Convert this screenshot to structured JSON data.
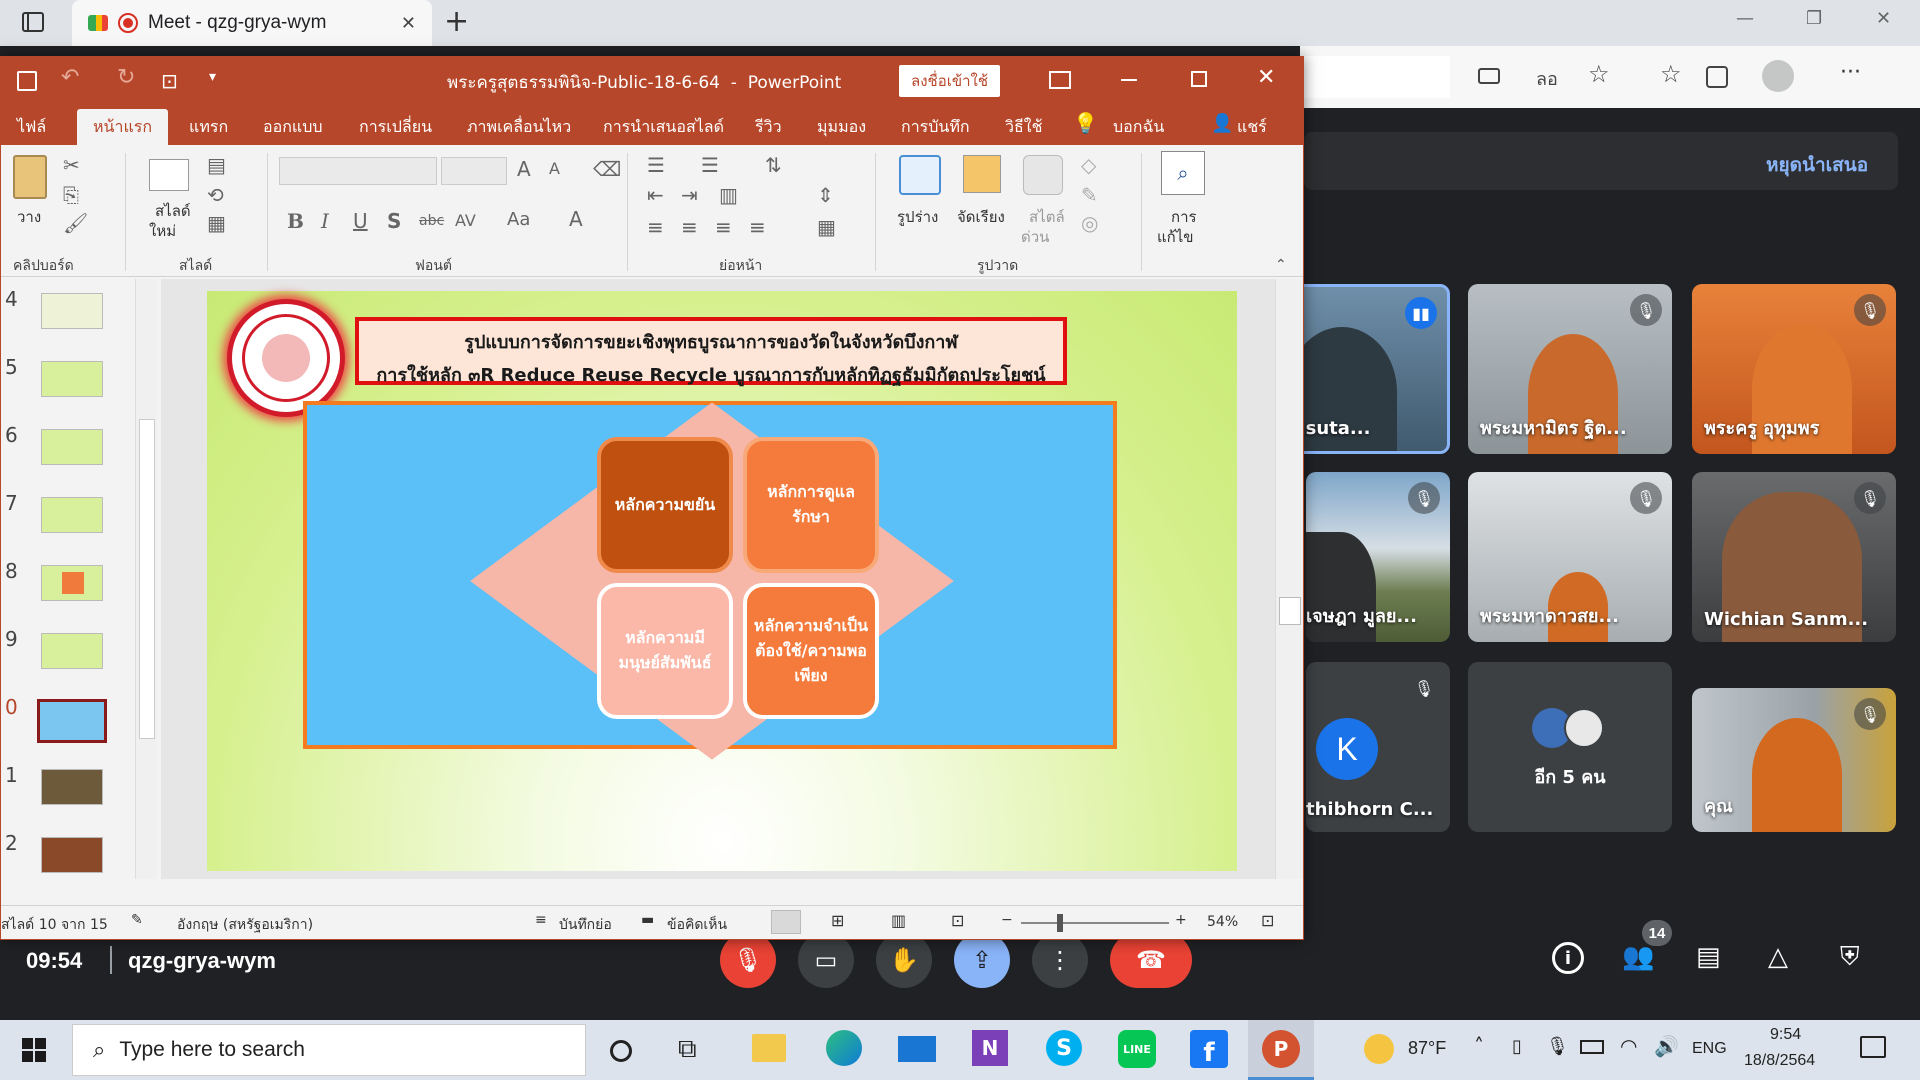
{
  "browser": {
    "tab_title": "Meet - qzg-grya-wym",
    "new_tab": "+",
    "window_controls": [
      "—",
      "❐",
      "✕"
    ],
    "toolbar_icons": [
      "camera-icon",
      "translate-icon",
      "add-favorite-icon",
      "favorites-icon",
      "collections-icon",
      "profile-icon",
      "more-icon"
    ],
    "translate_label": "ลอ",
    "more_label": "···"
  },
  "meet": {
    "stop_presenting": "หยุดนำเสนอ",
    "time": "09:54",
    "meeting_code": "qzg-grya-wym",
    "participants_count": "14",
    "more_people": "อีก 5 คน",
    "participants": [
      {
        "name": "akhrusuta...",
        "speaking": true
      },
      {
        "name": "พระมหามิตร ฐิต...",
        "muted": true
      },
      {
        "name": "พระครู อุทุมพร",
        "muted": true
      },
      {
        "name": "เจษฎา มูลย...",
        "muted": true
      },
      {
        "name": "พระมหาดาวสย...",
        "muted": true
      },
      {
        "name": "Wichian Sanm...",
        "muted": true
      },
      {
        "name": "thibhorn C...",
        "muted": true,
        "initial": "K"
      },
      {
        "name": "คุณ",
        "muted": true
      }
    ]
  },
  "ppt": {
    "title": "พระครูสุตธรรมพินิจ-Public-18-6-64  -  PowerPoint",
    "signin": "ลงชื่อเข้าใช้",
    "menu": [
      "ไฟล์",
      "หน้าแรก",
      "แทรก",
      "ออกแบบ",
      "การเปลี่ยน",
      "ภาพเคลื่อนไหว",
      "การนำเสนอสไลด์",
      "รีวิว",
      "มุมมอง",
      "การบันทึก",
      "วิธีใช้",
      "บอกฉัน",
      "แชร์"
    ],
    "ribbon": {
      "paste": "วาง",
      "new_slide_1": "สไลด์",
      "new_slide_2": "ใหม่",
      "shapes": "รูปร่าง",
      "arrange": "จัดเรียง",
      "quick_styles_1": "สไตล์",
      "quick_styles_2": "ด่วน",
      "editing_1": "การ",
      "editing_2": "แก้ไข",
      "groups": [
        "คลิปบอร์ด",
        "สไลด์",
        "ฟอนต์",
        "ย่อหน้า",
        "รูปวาด"
      ],
      "font_buttons": [
        "B",
        "I",
        "U",
        "S",
        "abc",
        "AV",
        "Aa",
        "A"
      ]
    },
    "thumb_numbers": [
      "4",
      "5",
      "6",
      "7",
      "8",
      "9",
      "0",
      "1",
      "2"
    ],
    "status": {
      "slide": "สไลด์ 10 จาก 15",
      "language": "อังกฤษ (สหรัฐอเมริกา)",
      "notes": "บันทึกย่อ",
      "comments": "ข้อคิดเห็น",
      "zoom": "54%"
    },
    "slide": {
      "title_line1": "รูปแบบการจัดการขยะเชิงพุทธบูรณาการของวัดในจังหวัดบึงกาฬ",
      "title_line2": "การใช้หลัก ๓R Reduce Reuse Recycle บูรณาการกับหลักทิฏฐธัมมิกัตถประโยชน์",
      "box1": "หลักความขยัน",
      "box2": "หลักการดูแลรักษา",
      "box3": "หลักความมีมนุษย์สัมพันธ์",
      "box4": "หลักความจำเป็นต้องใช้/ความพอเพียง"
    }
  },
  "taskbar": {
    "search_placeholder": "Type here to search",
    "weather": "87°F",
    "lang": "ENG",
    "clock_time": "9:54",
    "clock_date": "18/8/2564"
  },
  "colors": {
    "ppt_red": "#b7472a",
    "meet_bg": "#202124",
    "end_call": "#ea4335",
    "present_blue": "#8ab4f8"
  }
}
